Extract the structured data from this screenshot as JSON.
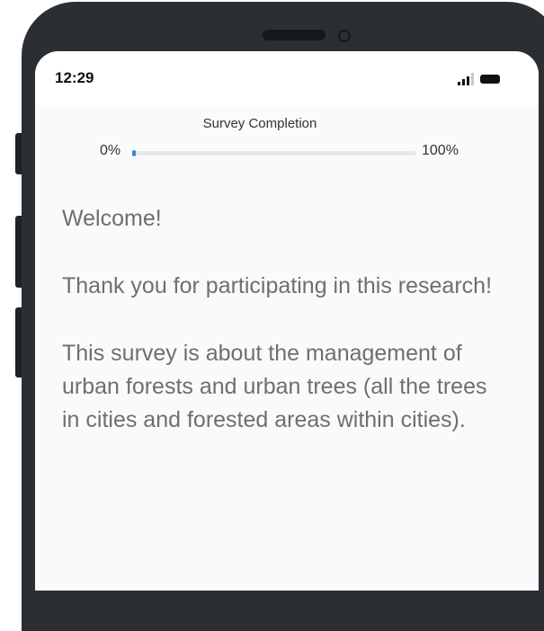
{
  "status_bar": {
    "time": "12:29"
  },
  "progress": {
    "title": "Survey Completion",
    "min_label": "0%",
    "max_label": "100%",
    "value_fraction": 0.0,
    "fill_color": "#3b8ad9"
  },
  "content": {
    "welcome": "Welcome!",
    "thanks": "Thank you for participating in this research!",
    "about": "This survey is about the management of urban forests and urban trees (all the trees in cities and forested areas within cities)."
  },
  "icons": {
    "signal": "signal-icon",
    "battery": "battery-icon"
  }
}
